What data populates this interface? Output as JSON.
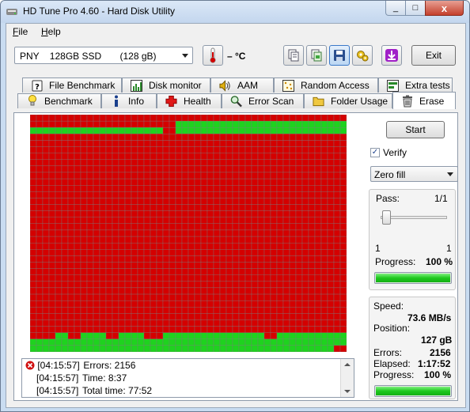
{
  "window": {
    "title": "HD Tune Pro 4.60 - Hard Disk Utility",
    "close_glyph": "x",
    "min_glyph": "_",
    "max_glyph": "□"
  },
  "menu": [
    {
      "label": "File",
      "underline": "F",
      "rest": "ile"
    },
    {
      "label": "Help",
      "underline": "H",
      "rest": "elp"
    }
  ],
  "toolbar": {
    "drive": "PNY    128GB SSD       (128 gB)",
    "temperature": "– °C",
    "exit_label": "Exit",
    "icons": [
      "copy-info-icon",
      "copy-screenshot-icon",
      "save-icon",
      "options-icon",
      "download-icon"
    ]
  },
  "tabs_back": [
    {
      "label": "File Benchmark",
      "icon": "file-benchmark-icon"
    },
    {
      "label": "Disk monitor",
      "icon": "disk-monitor-icon"
    },
    {
      "label": "AAM",
      "icon": "speaker-icon"
    },
    {
      "label": "Random Access",
      "icon": "random-access-icon"
    },
    {
      "label": "Extra tests",
      "icon": "extra-tests-icon"
    }
  ],
  "tabs_front": [
    {
      "label": "Benchmark",
      "icon": "benchmark-icon"
    },
    {
      "label": "Info",
      "icon": "info-icon"
    },
    {
      "label": "Health",
      "icon": "health-cross-icon"
    },
    {
      "label": "Error Scan",
      "icon": "magnifier-icon"
    },
    {
      "label": "Folder Usage",
      "icon": "folder-icon"
    },
    {
      "label": "Erase",
      "icon": "trash-icon",
      "active": true
    }
  ],
  "erase_map": {
    "columns": 50,
    "rows": 37,
    "colors": {
      "pending": "#d40000",
      "done": "#1fd21f",
      "grid": "#7a7a7a"
    },
    "note_green_rows": [
      1,
      2,
      34,
      35,
      36
    ]
  },
  "log": [
    {
      "time": "[04:15:57]",
      "text": "Errors: 2156",
      "icon": "error-icon"
    },
    {
      "time": "[04:15:57]",
      "text": "Time: 8:37"
    },
    {
      "time": "[04:15:57]",
      "text": "Total time: 77:52"
    }
  ],
  "controls": {
    "start_label": "Start",
    "verify_label": "Verify",
    "verify_checked": true,
    "fill_mode": "Zero fill"
  },
  "pass": {
    "label": "Pass:",
    "value": "1/1",
    "min": "1",
    "max": "1",
    "progress_label": "Progress:",
    "progress_text": "100 %",
    "progress_fraction": 1.0
  },
  "stats": {
    "speed_label": "Speed:",
    "speed": "73.6 MB/s",
    "position_label": "Position:",
    "position": "127 gB",
    "errors_label": "Errors:",
    "errors": "2156",
    "elapsed_label": "Elapsed:",
    "elapsed": "1:17:52",
    "progress_label": "Progress:",
    "progress_text": "100 %",
    "progress_fraction": 1.0
  }
}
